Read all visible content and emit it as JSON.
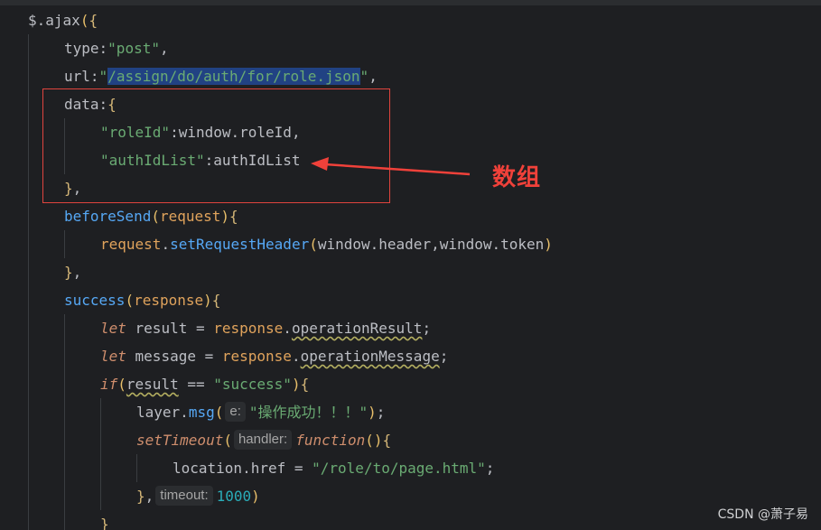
{
  "code": {
    "l1": {
      "a": "$",
      "b": ".ajax",
      "c": "(",
      "d": "{"
    },
    "l2": {
      "key": "type",
      "colon": ":",
      "val": "\"post\"",
      "comma": ","
    },
    "l3": {
      "key": "url",
      "colon": ":",
      "q1": "\"",
      "val": "/assign/do/auth/for/role.json",
      "q2": "\"",
      "comma": ","
    },
    "l4": {
      "key": "data",
      "colon": ":",
      "brace": "{"
    },
    "l5": {
      "key": "\"roleId\"",
      "colon": ":",
      "val": "window.roleId",
      "comma": ","
    },
    "l6": {
      "key": "\"authIdList\"",
      "colon": ":",
      "val": "authIdList"
    },
    "l7": {
      "brace": "}",
      "comma": ","
    },
    "l8": {
      "fn": "beforeSend",
      "p1": "(",
      "param": "request",
      "p2": ")",
      "brace": "{"
    },
    "l9": {
      "obj": "request",
      "dot": ".",
      "fn": "setRequestHeader",
      "p1": "(",
      "args": "window.header,window.token",
      "p2": ")"
    },
    "l10": {
      "brace": "}",
      "comma": ","
    },
    "l11": {
      "fn": "success",
      "p1": "(",
      "param": "response",
      "p2": ")",
      "brace": "{"
    },
    "l12": {
      "kw": "let",
      "name": " result = ",
      "obj": "response",
      "dot": ".",
      "prop": "operationResult",
      "semi": ";"
    },
    "l13": {
      "kw": "let",
      "name": " message = ",
      "obj": "response",
      "dot": ".",
      "prop": "operationMessage",
      "semi": ";"
    },
    "l14": {
      "kw": "if",
      "p1": "(",
      "name": "result",
      "op": " == ",
      "val": "\"success\"",
      "p2": ")",
      "brace": "{"
    },
    "l15": {
      "obj": "layer",
      "dot": ".",
      "fn": "msg",
      "p1": "(",
      "hint": "e:",
      "val": "\"操作成功！！！\"",
      "p2": ")",
      "semi": ";"
    },
    "l16": {
      "fn": "setTimeout",
      "p1": "(",
      "hint": "handler:",
      "kw": "function",
      "p2": "()",
      "brace": "{"
    },
    "l17": {
      "obj": "location",
      "dot": ".",
      "prop": "href",
      "op": " = ",
      "val": "\"/role/to/page.html\"",
      "semi": ";"
    },
    "l18": {
      "brace": "}",
      "comma": ",",
      "hint": "timeout:",
      "num": "1000",
      "p2": ")"
    },
    "l19": {
      "brace": "}"
    }
  },
  "annotation": {
    "label": "数组",
    "color": "#f0413a"
  },
  "watermark": "CSDN @萧子易",
  "colors": {
    "background": "#1e1f22",
    "string": "#6aab73",
    "keyword": "#cf8e6d",
    "function": "#56a8f5",
    "parameter": "#e0a35c",
    "number": "#2aacb8"
  }
}
